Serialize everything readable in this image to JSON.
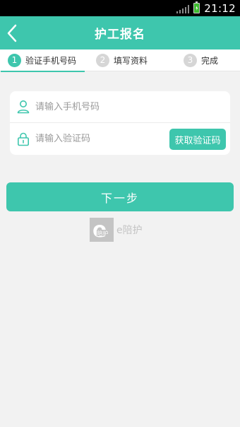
{
  "status_bar": {
    "time": "21:12"
  },
  "header": {
    "title": "护工报名"
  },
  "steps": [
    {
      "num": "1",
      "label": "验证手机号码"
    },
    {
      "num": "2",
      "label": "填写资料"
    },
    {
      "num": "3",
      "label": "完成"
    }
  ],
  "form": {
    "phone_placeholder": "请输入手机号码",
    "phone_value": "",
    "code_placeholder": "请输入验证码",
    "code_value": "",
    "get_code_label": "获取验证码"
  },
  "next_label": "下一步",
  "brand": {
    "logo_letter": "e",
    "logo_sub": "陪护",
    "name": "e陪护"
  },
  "colors": {
    "accent": "#3ec6ad",
    "status_bar": "#000000",
    "background": "#f2f2f2",
    "step_inactive": "#d6d6d6"
  },
  "icons": {
    "back": "chevron-left-icon",
    "phone": "user-icon",
    "code": "lock-icon",
    "battery": "battery-icon",
    "signal": "signal-icon"
  }
}
